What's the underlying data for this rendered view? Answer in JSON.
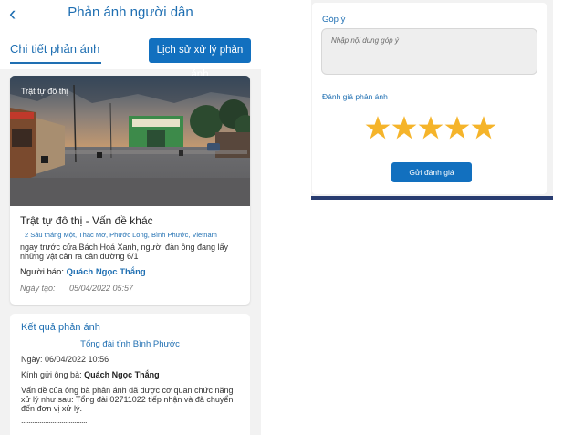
{
  "header": {
    "back_icon": "chevron-left-icon",
    "title": "Phản ánh người dân"
  },
  "tabs": {
    "detail_label": "Chi tiết phản ánh",
    "history_button": "Lịch sử xử lý phản ánh"
  },
  "report": {
    "photo_tag": "Trật tự đô thị",
    "title": "Trật tự đô thị - Vấn đề khác",
    "address": "2 Sáu tháng Một, Thác Mơ, Phước Long, Bình Phước, Vietnam",
    "description": "ngay trước cửa Bách Hoá Xanh, người đàn ông đang lấy những vật cản ra cản đường 6/1",
    "reporter_label": "Người báo:",
    "reporter_name": "Quách Ngọc Thắng",
    "created_label": "Ngày tạo:",
    "created_value": "05/04/2022 05:57"
  },
  "result": {
    "title": "Kết quả phản ánh",
    "org": "Tổng đài tỉnh Bình Phước",
    "date": "Ngày: 06/04/2022 10:56",
    "greeting_prefix": "Kính gửi ông bà:",
    "greeting_name": "Quách Ngọc Thắng",
    "body": "Vấn đề của ông bà phản ánh đã được cơ quan chức năng xử lý như sau: Tổng đài 02711022 tiếp nhận và đã chuyển đến đơn vị xử lý.",
    "ellipsis": "...................................."
  },
  "feedback": {
    "label": "Góp ý",
    "placeholder": "Nhập nội dung góp ý",
    "rating_label": "Đánh giá phản ánh",
    "rating": 5,
    "rating_max": 5,
    "star_color": "#f5b42a",
    "submit_label": "Gửi đánh giá"
  },
  "colors": {
    "accent": "#1f6fb2",
    "button": "#1270bf"
  }
}
